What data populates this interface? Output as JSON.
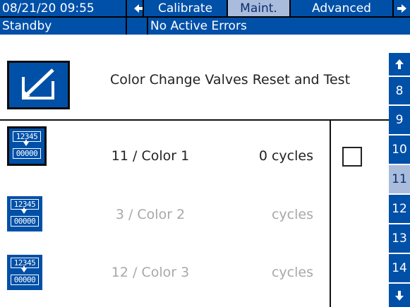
{
  "header": {
    "datetime": "08/21/20 09:55",
    "tabs": [
      {
        "label": "Calibrate",
        "active": false
      },
      {
        "label": "Maint.",
        "active": true
      },
      {
        "label": "Advanced",
        "active": false
      }
    ],
    "status": "Standby",
    "errors": "No Active Errors"
  },
  "screen": {
    "title": "Color Change Valves Reset and Test"
  },
  "rows": [
    {
      "name": "11 / Color 1",
      "cycles": "0 cycles",
      "enabled": true
    },
    {
      "name": "3 / Color 2",
      "cycles": "cycles",
      "enabled": false
    },
    {
      "name": "12 / Color 3",
      "cycles": "cycles",
      "enabled": false
    }
  ],
  "counter_icon": {
    "top": "12345",
    "bottom": "00000"
  },
  "side_tabs": [
    "8",
    "9",
    "10",
    "11",
    "12",
    "13",
    "14"
  ],
  "side_tab_active": "11",
  "icons": {
    "nav_back": "arrow-left-icon",
    "nav_forward": "arrow-right-icon",
    "edit": "edit-pencil-icon",
    "counter": "counter-reset-icon",
    "scroll_up": "arrow-up-icon",
    "scroll_down": "arrow-down-icon"
  },
  "colors": {
    "primary": "#0050a8",
    "active_tab": "#a9bcdc",
    "dim_text": "#a8a8a8"
  }
}
